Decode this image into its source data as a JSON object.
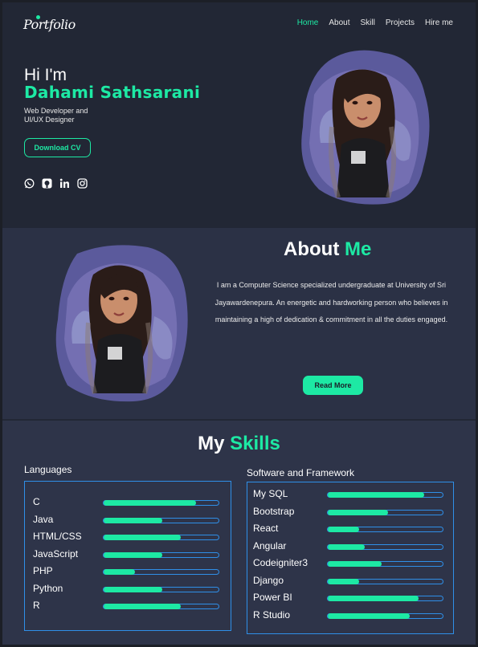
{
  "nav": {
    "logo": "Portfolio",
    "items": [
      "Home",
      "About",
      "Skill",
      "Projects",
      "Hire me"
    ],
    "active": "Home"
  },
  "hero": {
    "greeting": "Hi I'm",
    "name": "Dahami Sathsarani",
    "role_line1": "Web Developer and",
    "role_line2": "UI/UX Designer",
    "cta": "Download CV",
    "socials": [
      "whatsapp-icon",
      "github-icon",
      "linkedin-icon",
      "instagram-icon"
    ]
  },
  "about": {
    "title_white": "About ",
    "title_green": "Me",
    "paragraph": "I am a Computer Science specialized undergraduate at University of Sri Jayawardenepura. An energetic and hardworking person who believes in maintaining a high of dedication & commitment in all the duties engaged.",
    "cta": "Read More"
  },
  "skills": {
    "title_white": "My ",
    "title_green": "Skills",
    "languages": {
      "title": "Languages",
      "items": [
        {
          "label": "C",
          "level": 0.79
        },
        {
          "label": "Java",
          "level": 0.5
        },
        {
          "label": "HTML/CSS",
          "level": 0.66
        },
        {
          "label": "JavaScript",
          "level": 0.5
        },
        {
          "label": "PHP",
          "level": 0.27
        },
        {
          "label": "Python",
          "level": 0.5
        },
        {
          "label": "R",
          "level": 0.66
        }
      ]
    },
    "software": {
      "title": "Software and Framework",
      "items": [
        {
          "label": "My SQL",
          "level": 0.83
        },
        {
          "label": "Bootstrap",
          "level": 0.52
        },
        {
          "label": "React",
          "level": 0.27
        },
        {
          "label": "Angular",
          "level": 0.32
        },
        {
          "label": "Codeigniter3",
          "level": 0.46
        },
        {
          "label": "Django",
          "level": 0.27
        },
        {
          "label": "Power BI",
          "level": 0.78
        },
        {
          "label": "R Studio",
          "level": 0.7
        }
      ]
    }
  },
  "colors": {
    "accent": "#1de9a4",
    "border": "#2f8fe8",
    "hero_bg": "#222735",
    "about_bg": "#2b3145",
    "skills_bg": "#2e3449"
  }
}
